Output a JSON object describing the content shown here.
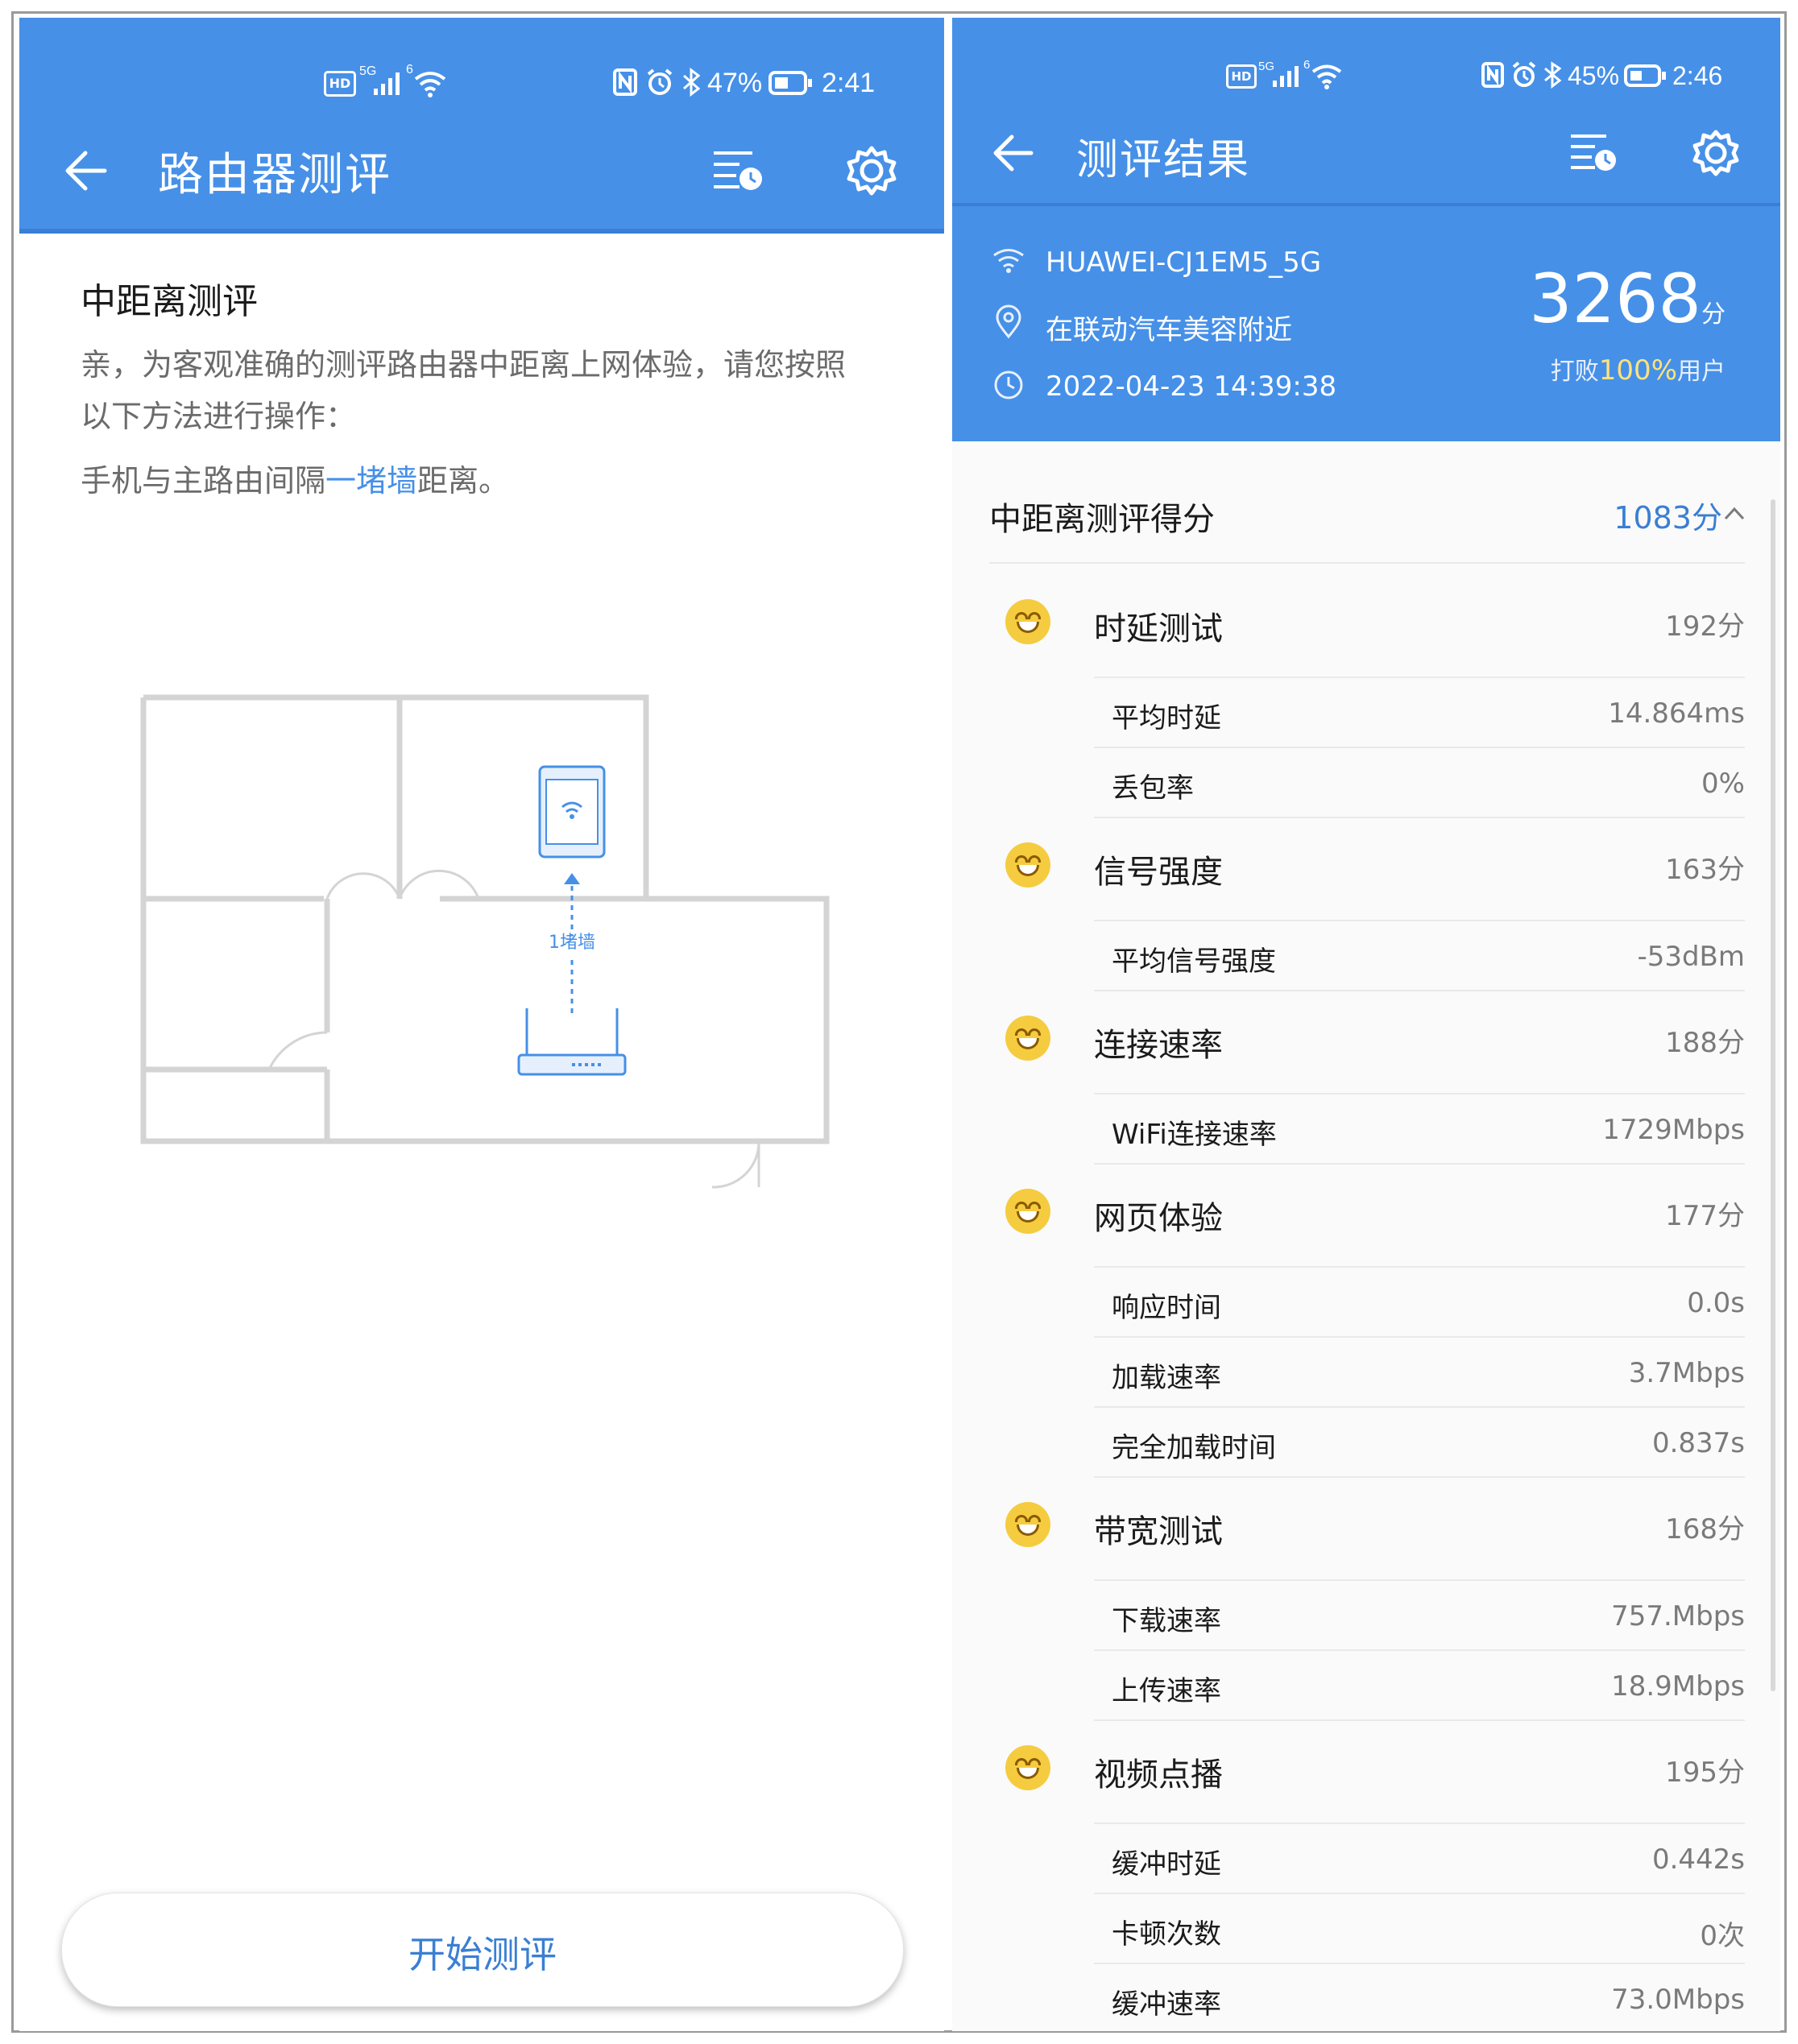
{
  "left": {
    "status": {
      "network": "5G",
      "wifi": "6",
      "battery": "47%",
      "time": "2:41"
    },
    "appbar": {
      "title": "路由器测评"
    },
    "section_title": "中距离测评",
    "desc_line1": "亲，为客观准确的测评路由器中距离上网体验，请您按照",
    "desc_line2": "以下方法进行操作：",
    "instruction_prefix": "手机与主路由间隔",
    "instruction_link": "一堵墙",
    "instruction_suffix": "距离。",
    "diagram_label": "1堵墙",
    "start_button": "开始测评"
  },
  "right": {
    "status": {
      "network": "5G",
      "wifi": "6",
      "battery": "45%",
      "time": "2:46"
    },
    "appbar": {
      "title": "测评结果"
    },
    "wifi_name": "HUAWEI-CJ1EM5_5G",
    "location": "在联动汽车美容附近",
    "datetime": "2022-04-23 14:39:38",
    "total_score": "3268",
    "score_unit": "分",
    "beat_prefix": "打败",
    "beat_value": "100%",
    "beat_suffix": "用户",
    "section": {
      "label": "中距离测评得分",
      "score": "1083分"
    },
    "groups": [
      {
        "name": "时延测试",
        "score": "192分",
        "items": [
          {
            "label": "平均时延",
            "value": "14.864ms"
          },
          {
            "label": "丢包率",
            "value": "0%"
          }
        ]
      },
      {
        "name": "信号强度",
        "score": "163分",
        "items": [
          {
            "label": "平均信号强度",
            "value": "-53dBm"
          }
        ]
      },
      {
        "name": "连接速率",
        "score": "188分",
        "items": [
          {
            "label": "WiFi连接速率",
            "value": "1729Mbps"
          }
        ]
      },
      {
        "name": "网页体验",
        "score": "177分",
        "items": [
          {
            "label": "响应时间",
            "value": "0.0s"
          },
          {
            "label": "加载速率",
            "value": "3.7Mbps"
          },
          {
            "label": "完全加载时间",
            "value": "0.837s"
          }
        ]
      },
      {
        "name": "带宽测试",
        "score": "168分",
        "items": [
          {
            "label": "下载速率",
            "value": "757.Mbps"
          },
          {
            "label": "上传速率",
            "value": "18.9Mbps"
          }
        ]
      },
      {
        "name": "视频点播",
        "score": "195分",
        "items": [
          {
            "label": "缓冲时延",
            "value": "0.442s"
          },
          {
            "label": "卡顿次数",
            "value": "0次"
          },
          {
            "label": "缓冲速率",
            "value": "73.0Mbps"
          }
        ]
      }
    ]
  },
  "colors": {
    "primary": "#4690e8",
    "face": "#f5cc40",
    "text": "#1b1b1b",
    "muted": "#7a7a7a"
  }
}
